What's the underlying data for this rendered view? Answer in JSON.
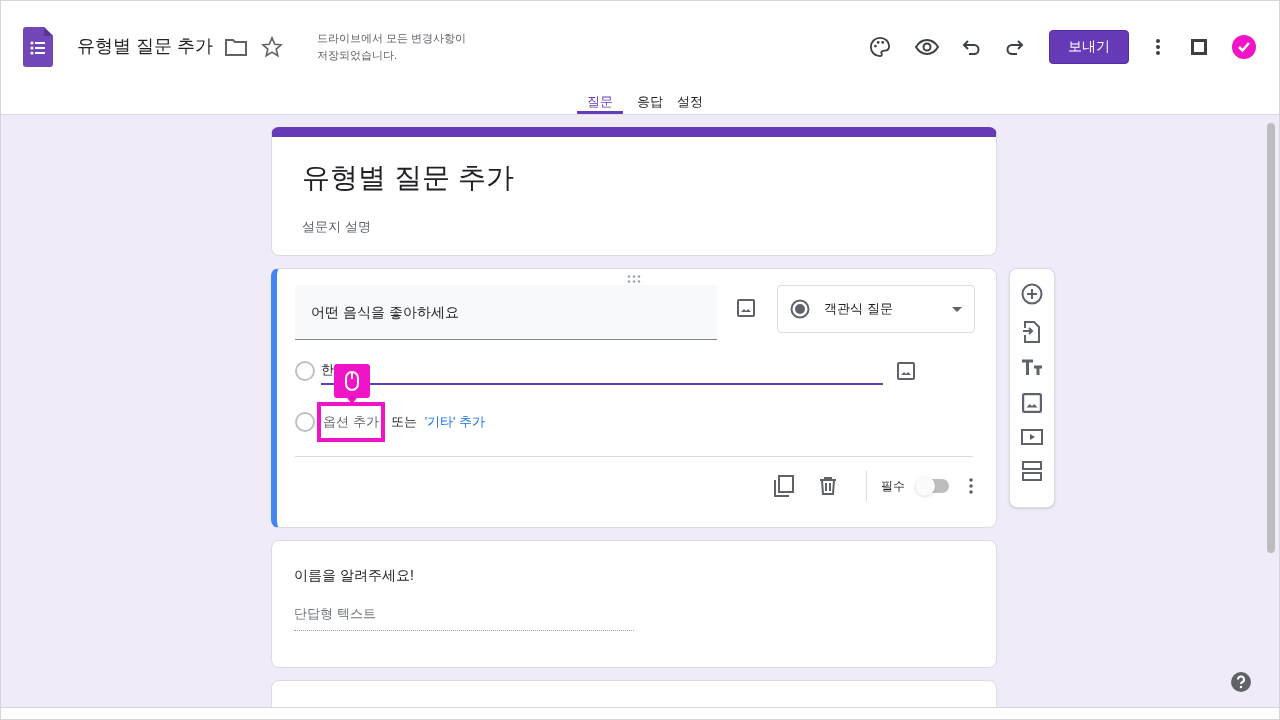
{
  "header": {
    "title": "유형별 질문 추가",
    "save_status": "드라이브에서 모든 변경사항이 저장되었습니다.",
    "send_button": "보내기"
  },
  "tabs": [
    {
      "label": "질문",
      "selected": true
    },
    {
      "label": "응답",
      "selected": false
    },
    {
      "label": "설정",
      "selected": false
    }
  ],
  "form": {
    "title": "유형별 질문 추가",
    "description": "설문지 설명"
  },
  "question": {
    "title": "어떤 음식을 좋아하세요",
    "type": "객관식 질문",
    "options": [
      {
        "value": "한",
        "selected": false
      }
    ],
    "add_option": "옵션 추가",
    "or": "또는",
    "add_other": "'기타' 추가",
    "required_label": "필수",
    "required": false
  },
  "question_2": {
    "title": "이름을 알려주세요!",
    "placeholder": "단답형 텍스트"
  }
}
